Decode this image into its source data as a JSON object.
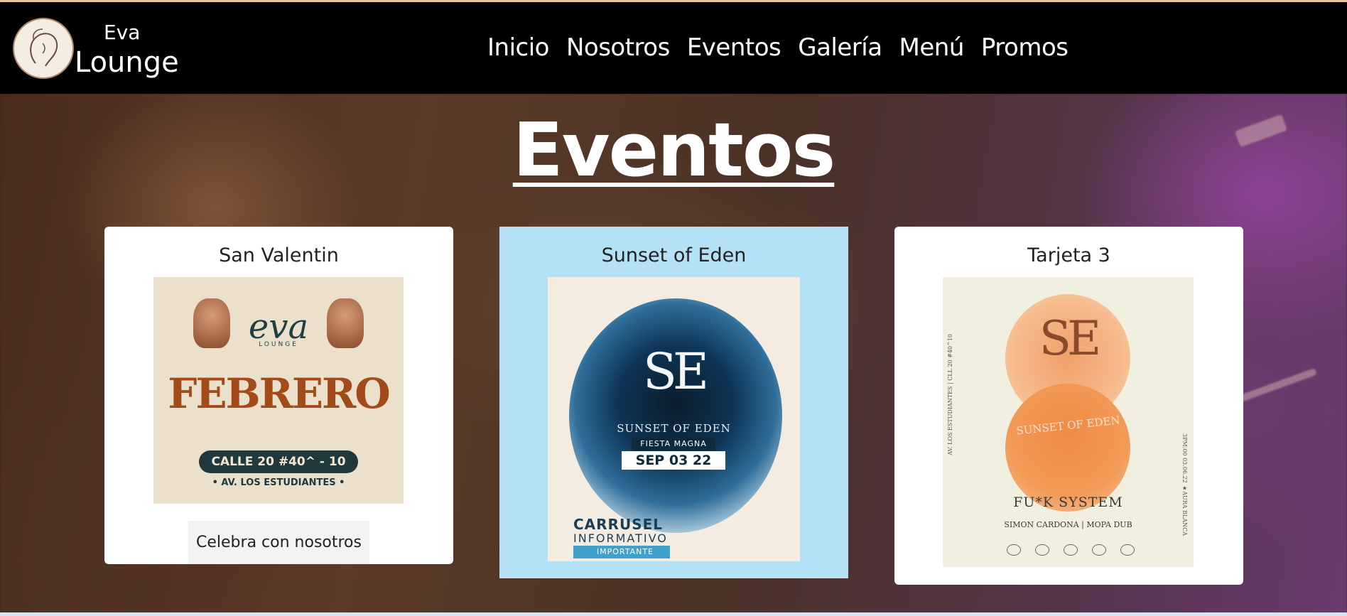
{
  "brand": {
    "name_top": "Eva",
    "name_bottom": "Lounge"
  },
  "nav": {
    "items": [
      "Inicio",
      "Nosotros",
      "Eventos",
      "Galería",
      "Menú",
      "Promos"
    ]
  },
  "section": {
    "title": "Eventos"
  },
  "cards": [
    {
      "title": "San Valentin",
      "poster": {
        "brand": "eva",
        "brand_sub": "LOUNGE",
        "headline": "FEBRERO",
        "address": "CALLE 20 #40^ - 10",
        "address_sub": "• AV. LOS ESTUDIANTES •"
      },
      "button_label": "Celebra con nosotros"
    },
    {
      "title": "Sunset of Eden",
      "poster": {
        "logo": "SE",
        "name": "SUNSET OF EDEN",
        "tag": "FIESTA MAGNA",
        "date": "SEP 03 22",
        "carrusel": "CARRUSEL",
        "informativo": "INFORMATIVO",
        "importante": "IMPORTANTE"
      }
    },
    {
      "title": "Tarjeta 3",
      "poster": {
        "logo": "SE",
        "name": "SUNSET OF EDEN",
        "headline": "FU*K SYSTEM",
        "artists": "SIMON CARDONA | MOPA DUB",
        "side_left": "AV. LOS ESTUDIANTES | CLL 20 #40^10",
        "side_right": "3PM:00  03.06.22  ★AURA BLANCA"
      }
    }
  ]
}
